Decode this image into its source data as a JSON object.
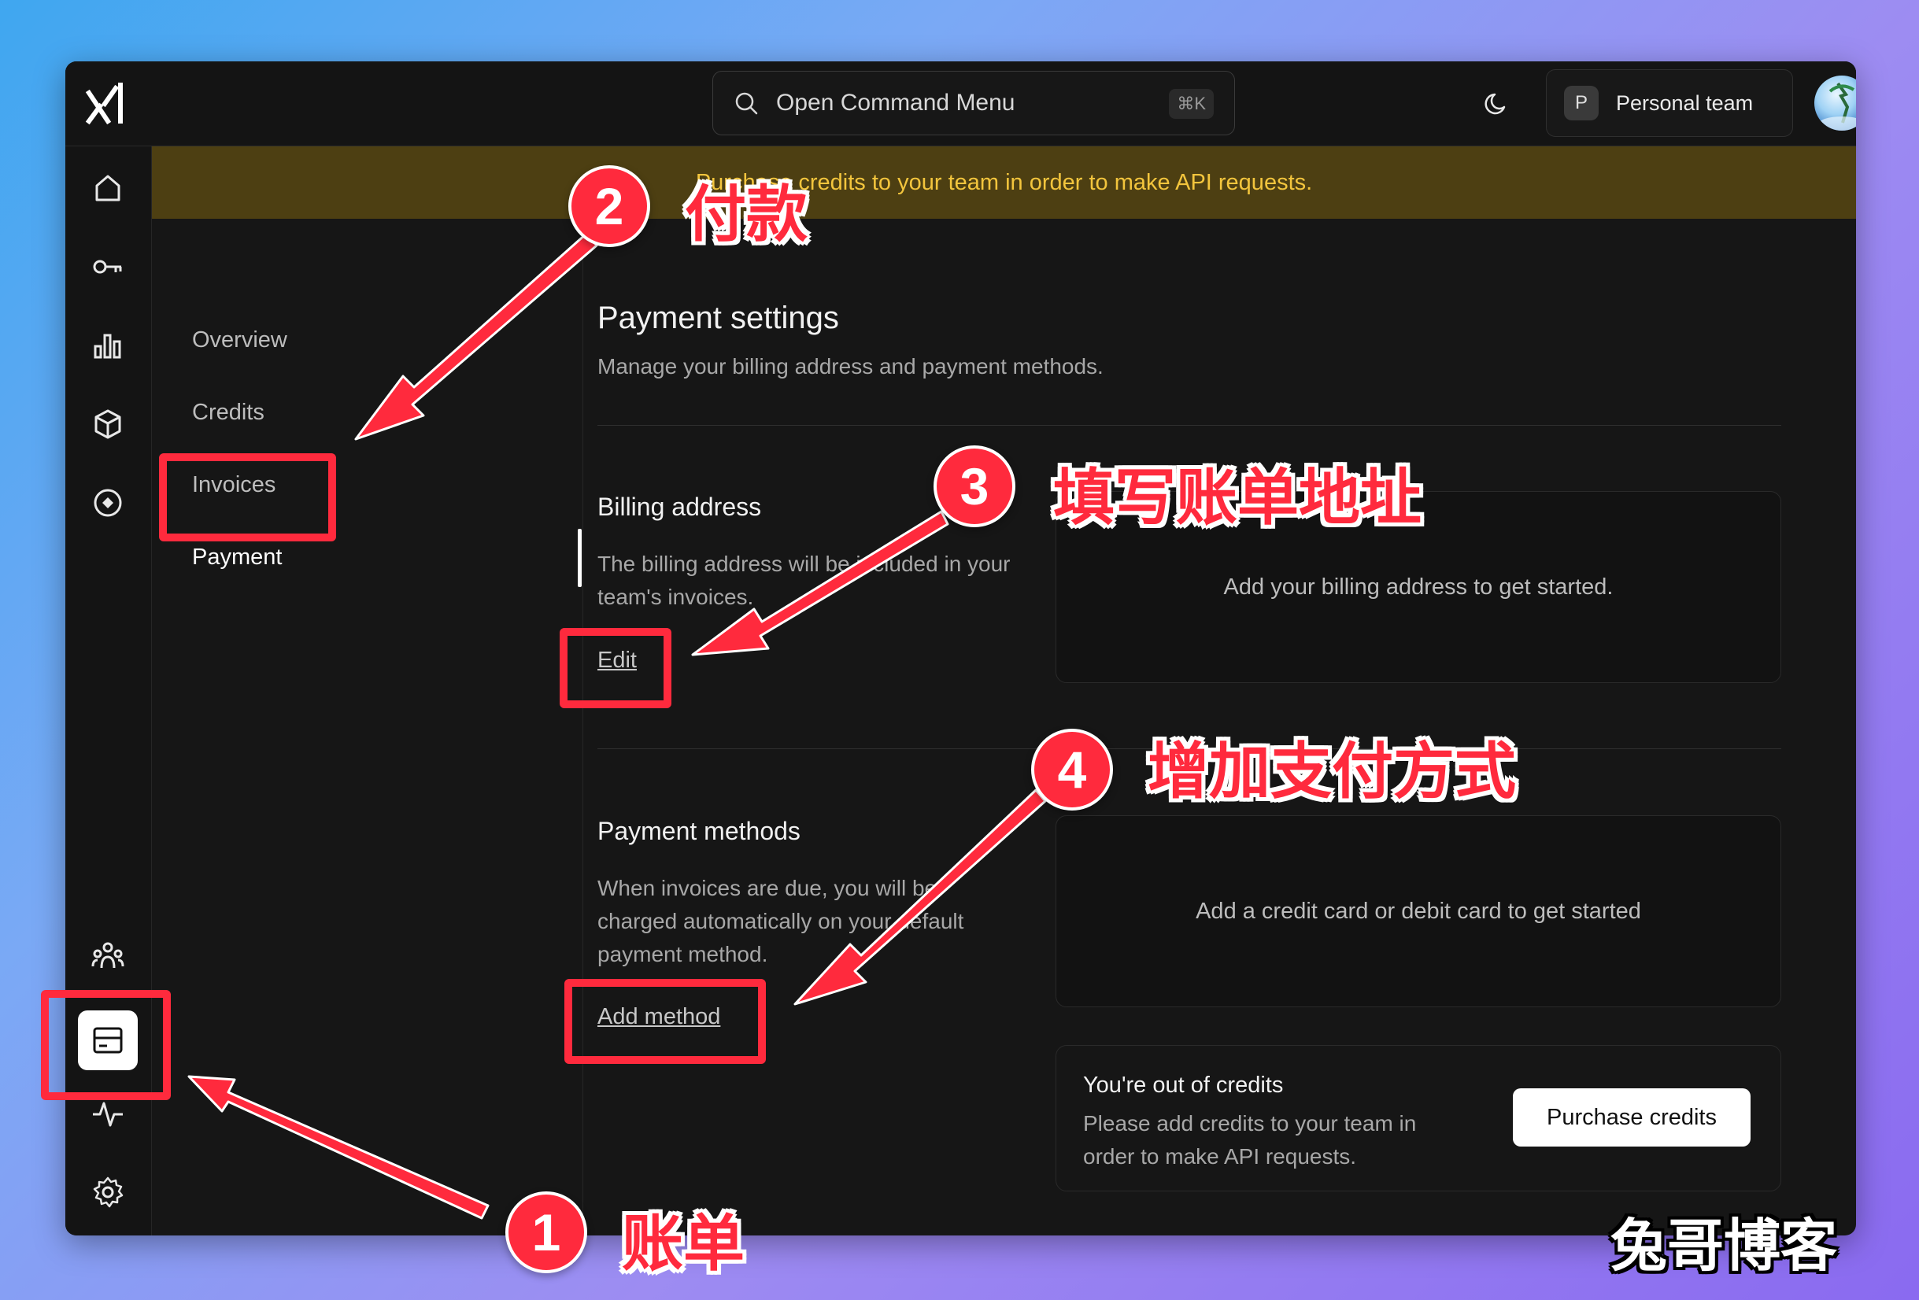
{
  "topbar": {
    "search_placeholder": "Open Command Menu",
    "search_shortcut": "⌘K",
    "team_initial": "P",
    "team_name": "Personal team"
  },
  "iconbar": {
    "icons": [
      "home-icon",
      "key-icon",
      "bar-chart-icon",
      "cube-icon",
      "compass-icon",
      "team-icon",
      "billing-icon",
      "activity-icon",
      "gear-icon"
    ],
    "active": "billing-icon"
  },
  "banner": {
    "text": "Purchase credits to your team in order to make API requests."
  },
  "subnav": {
    "items": [
      {
        "label": "Overview"
      },
      {
        "label": "Credits"
      },
      {
        "label": "Invoices"
      },
      {
        "label": "Payment"
      }
    ],
    "active": "Payment"
  },
  "main": {
    "title": "Payment settings",
    "subtitle": "Manage your billing address and payment methods.",
    "billing": {
      "title": "Billing address",
      "description": "The billing address will be included in your team's invoices.",
      "action": "Edit",
      "placeholder": "Add your billing address to get started."
    },
    "methods": {
      "title": "Payment methods",
      "description": "When invoices are due, you will be charged automatically on your default payment method.",
      "action": "Add method",
      "placeholder": "Add a credit card or debit card to get started"
    },
    "credits_card": {
      "title": "You're out of credits",
      "description": "Please add credits to your team in order to make API requests.",
      "button": "Purchase credits"
    }
  },
  "annotations": [
    {
      "number": "1",
      "label": "账单"
    },
    {
      "number": "2",
      "label": "付款"
    },
    {
      "number": "3",
      "label": "填写账单地址"
    },
    {
      "number": "4",
      "label": "增加支付方式"
    }
  ],
  "watermark": "兔哥博客",
  "colors": {
    "annotation": "#ff2a3d",
    "banner_bg": "#4d3f12",
    "banner_text": "#f3c53d",
    "window_bg": "#161616"
  }
}
